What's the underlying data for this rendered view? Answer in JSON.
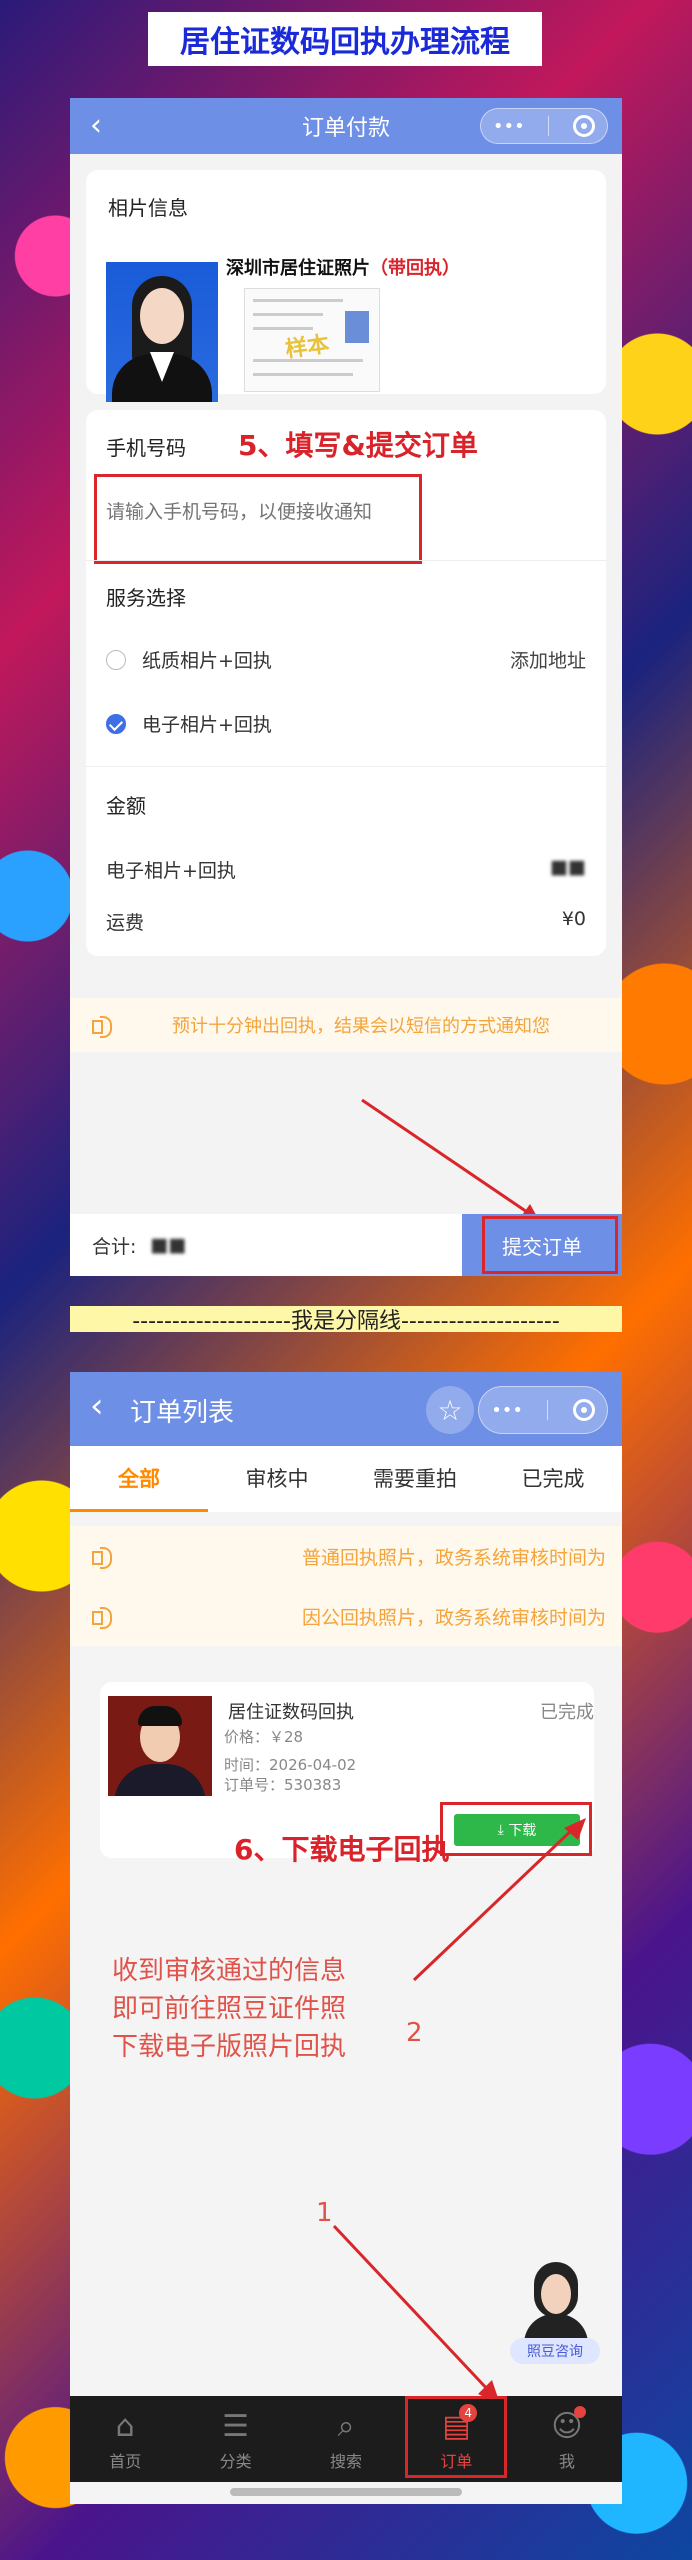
{
  "banner": "居住证数码回执办理流程",
  "screen1": {
    "nav": {
      "title": "订单付款",
      "back_icon": "chevron-left-icon",
      "more_icon": "more-dots-icon",
      "close_icon": "target-close-icon"
    },
    "photo": {
      "section_title": "相片信息",
      "label": "深圳市居住证照片",
      "label_suffix": "（带回执）",
      "sample_stamp": "样本"
    },
    "phone": {
      "section_title": "手机号码",
      "placeholder": "请输入手机号码，以便接收通知"
    },
    "step5": "5、填写&提交订单",
    "service": {
      "section_title": "服务选择",
      "options": [
        {
          "label": "纸质相片+回执",
          "selected": false
        },
        {
          "label": "电子相片+回执",
          "selected": true
        }
      ],
      "add_address": "添加地址"
    },
    "amount": {
      "section_title": "金额",
      "rows": [
        {
          "label": "电子相片+回执",
          "value": "■■"
        },
        {
          "label": "运费",
          "value": "¥0"
        }
      ]
    },
    "notice": "预计十分钟出回执，结果会以短信的方式通知您",
    "total_label": "合计:",
    "total_value": "■■",
    "submit": "提交订单"
  },
  "separator": "--------------------我是分隔线--------------------",
  "screen2": {
    "nav": {
      "title": "订单列表",
      "star_icon": "star-icon"
    },
    "tabs": [
      "全部",
      "审核中",
      "需要重拍",
      "已完成"
    ],
    "active_tab": 0,
    "notices": [
      "普通回执照片，政务系统审核时间为",
      "因公回执照片，政务系统审核时间为"
    ],
    "order": {
      "name": "居住证数码回执",
      "status": "已完成",
      "price": "价格：￥28",
      "time": "时间：2026-04-02",
      "order_no": "订单号：530383",
      "download": "下载"
    },
    "step6": "6、下载电子回执",
    "instructions": [
      "收到审核通过的信息",
      "即可前往照豆证件照",
      "下载电子版照片回执"
    ],
    "markers": [
      "1",
      "2"
    ],
    "assistant_tag": "照豆咨询",
    "tabbar": [
      {
        "label": "首页",
        "icon": "home-icon"
      },
      {
        "label": "分类",
        "icon": "category-icon"
      },
      {
        "label": "搜索",
        "icon": "search-icon"
      },
      {
        "label": "订单",
        "icon": "order-icon",
        "badge": "4"
      },
      {
        "label": "我",
        "icon": "user-icon"
      }
    ],
    "active_tabbar": 3
  },
  "colors": {
    "nav": "#6d8fe6",
    "accent_red": "#d9232a",
    "orange": "#ff8a00",
    "download_green": "#2fb84a"
  }
}
